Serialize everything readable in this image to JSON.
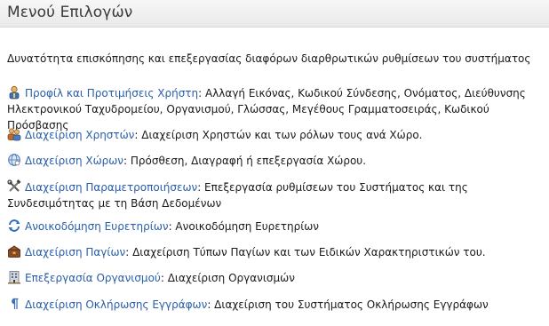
{
  "header": {
    "title": "Μενού Επιλογών"
  },
  "intro": "Δυνατότητα επισκόπησης και επεξεργασίας διαφόρων διαρθρωτικών ρυθμίσεων του συστήματος",
  "items": [
    {
      "icon": "user-preferences-icon",
      "link": "Προφίλ και Προτιμήσεις Χρήστη",
      "desc": ": Αλλαγή Εικόνας, Κωδικού Σύνδεσης, Ονόματος, Διεύθυνσης Ηλεκτρονικού Ταχυδρομείου, Οργανισμού, Γλώσσας, Μεγέθους Γραμματοσειράς, Κωδικού Πρόσβασης"
    },
    {
      "icon": "users-icon",
      "link": "Διαχείριση Χρηστών",
      "desc": ": Διαχείριση Χρηστών και των ρόλων τους ανά Χώρο."
    },
    {
      "icon": "spaces-icon",
      "link": "Διαχείριση Χώρων",
      "desc": ": Πρόσθεση, Διαγραφή ή επεξεργασία Χώρου."
    },
    {
      "icon": "tools-icon",
      "link": "Διαχείριση Παραμετροποιήσεων",
      "desc": ": Επεξεργασία ρυθμίσεων του Συστήματος και της Συνδεσιμότητας με τη Βάση Δεδομένων"
    },
    {
      "icon": "rebuild-index-icon",
      "link": "Ανοικοδόμηση Ευρετηρίων",
      "desc": ": Ανοικοδόμηση Ευρετηρίων"
    },
    {
      "icon": "assets-icon",
      "link": "Διαχείριση Παγίων",
      "desc": ": Διαχείριση Τύπων Παγίων και των Ειδικών Χαρακτηριστικών του."
    },
    {
      "icon": "organization-icon",
      "link": "Επεξεργασία Οργανισμού",
      "desc": ": Διαχείριση Οργανισμών"
    },
    {
      "icon": "paragraph-icon",
      "link": "Διαχείριση Οκλήρωσης Εγγράφων",
      "desc": ": Διαχείριση του Συστήματος Οκλήρωσης Εγγράφων"
    }
  ]
}
